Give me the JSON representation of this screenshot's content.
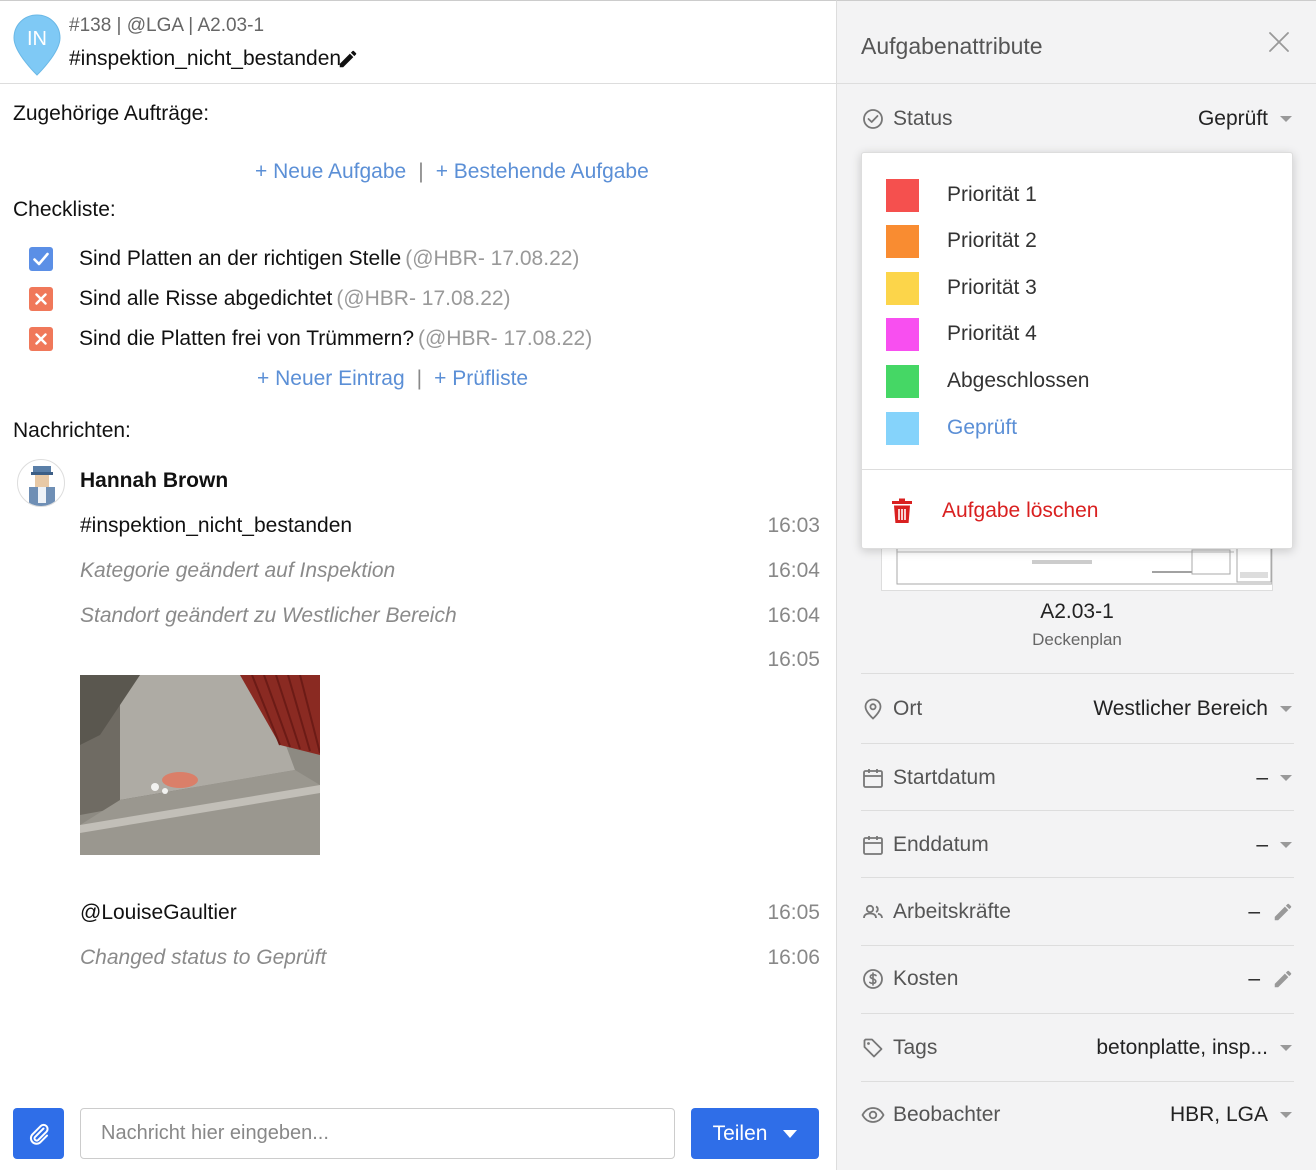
{
  "header": {
    "pin_initials": "IN",
    "meta": "#138 | @LGA | A2.03-1",
    "title": "#inspektion_nicht_bestanden"
  },
  "related": {
    "label": "Zugehörige Aufträge:",
    "new_task": "+ Neue Aufgabe",
    "separator": "|",
    "existing_task": "+ Bestehende Aufgabe"
  },
  "checklist": {
    "label": "Checkliste:",
    "items": [
      {
        "text": "Sind Platten an der richtigen Stelle",
        "meta": "(@HBR- 17.08.22)",
        "state": "checked"
      },
      {
        "text": "Sind alle Risse abgedichtet",
        "meta": "(@HBR- 17.08.22)",
        "state": "failed"
      },
      {
        "text": "Sind die Platten frei von Trümmern?",
        "meta": "(@HBR- 17.08.22)",
        "state": "failed"
      }
    ],
    "new_entry": "+ Neuer Eintrag",
    "checklist_link": "+ Prüfliste"
  },
  "messages": {
    "label": "Nachrichten:",
    "author": "Hannah Brown",
    "items": [
      {
        "text": "#inspektion_nicht_bestanden",
        "time": "16:03",
        "system": false
      },
      {
        "text": "Kategorie geändert auf Inspektion",
        "time": "16:04",
        "system": true
      },
      {
        "text": "Standort geändert zu Westlicher Bereich",
        "time": "16:04",
        "system": true
      }
    ],
    "photo_time": "16:05",
    "after_photo": [
      {
        "text": "@LouiseGaultier",
        "time": "16:05",
        "system": false
      },
      {
        "text": "Changed status to Geprüft",
        "time": "16:06",
        "system": true
      }
    ]
  },
  "composer": {
    "placeholder": "Nachricht hier eingeben...",
    "share_label": "Teilen"
  },
  "attributes": {
    "title": "Aufgabenattribute",
    "status": {
      "label": "Status",
      "value": "Geprüft"
    },
    "plan": {
      "name": "A2.03-1",
      "subtitle": "Deckenplan"
    },
    "location": {
      "label": "Ort",
      "value": "Westlicher Bereich"
    },
    "start_date": {
      "label": "Startdatum",
      "value": "–"
    },
    "end_date": {
      "label": "Enddatum",
      "value": "–"
    },
    "workers": {
      "label": "Arbeitskräfte",
      "value": "–"
    },
    "costs": {
      "label": "Kosten",
      "value": "–"
    },
    "tags": {
      "label": "Tags",
      "value": "betonplatte, insp..."
    },
    "watchers": {
      "label": "Beobachter",
      "value": "HBR, LGA"
    }
  },
  "status_menu": {
    "options": [
      {
        "label": "Priorität 1",
        "color": "#f5504e",
        "active": false
      },
      {
        "label": "Priorität 2",
        "color": "#f98c31",
        "active": false
      },
      {
        "label": "Priorität 3",
        "color": "#fcd54a",
        "active": false
      },
      {
        "label": "Priorität 4",
        "color": "#f84ff0",
        "active": false
      },
      {
        "label": "Abgeschlossen",
        "color": "#45d765",
        "active": false
      },
      {
        "label": "Geprüft",
        "color": "#85d3fb",
        "active": true
      }
    ],
    "delete_label": "Aufgabe löschen"
  },
  "colors": {
    "accent": "#2f6ee8",
    "link": "#5b8fd6",
    "checked": "#5b8fe6",
    "failed": "#f0785a",
    "danger": "#d92020",
    "pin": "#7fc9f5"
  }
}
